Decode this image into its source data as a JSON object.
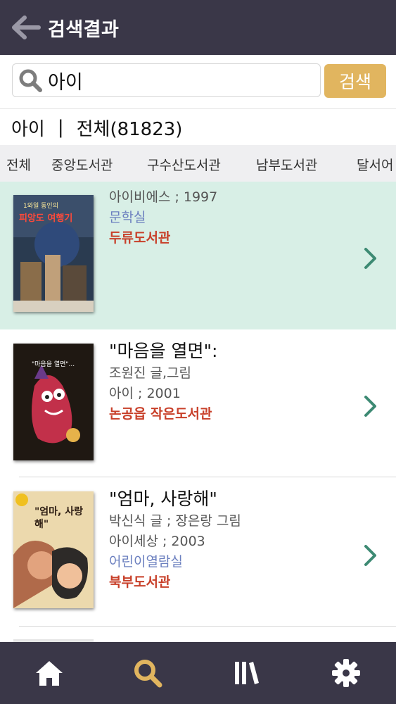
{
  "header": {
    "title": "검색결과"
  },
  "search": {
    "query": "아이",
    "button_label": "검색"
  },
  "summary": {
    "keyword": "아이",
    "separator": "|",
    "total": "전체(81823)"
  },
  "library_tabs": [
    "전체",
    "중앙도서관",
    "구수산도서관",
    "남부도서관",
    "달서어"
  ],
  "results": [
    {
      "title": "",
      "author": "",
      "publisher_year": "아이비에스 ; 1997",
      "room": "문학실",
      "library": "두류도서관"
    },
    {
      "title": "\"마음을 열면\":",
      "author": "조원진 글,그림",
      "publisher_year": "아이 ; 2001",
      "room": "",
      "library": "논공읍 작은도서관"
    },
    {
      "title": "\"엄마, 사랑해\"",
      "author": "박신식 글 ; 장은랑 그림",
      "publisher_year": "아이세상 ; 2003",
      "room": "어린이열람실",
      "library": "북부도서관"
    }
  ],
  "covers": [
    {
      "text": "피앙도 여행기",
      "top_text": "1와일 동인의"
    },
    {
      "text": "\"마음을 열면\"..."
    },
    {
      "text": "\"엄마, 사랑해\""
    }
  ],
  "colors": {
    "header_bg": "#3a3748",
    "accent": "#e1b55f",
    "highlight_row": "#d8efe6",
    "library_red": "#c8402a",
    "room_blue": "#6b7fbf",
    "chevron": "#3d8a73"
  },
  "tabbar": [
    {
      "icon": "home-icon"
    },
    {
      "icon": "search-icon",
      "active": true
    },
    {
      "icon": "books-icon"
    },
    {
      "icon": "gear-icon"
    }
  ]
}
